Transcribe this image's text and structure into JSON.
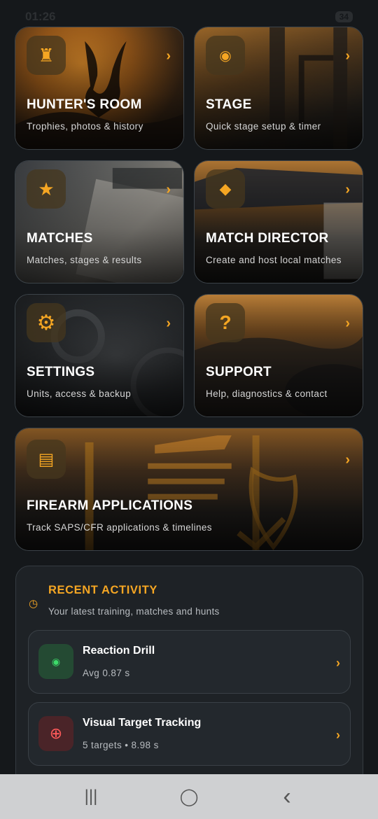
{
  "status": {
    "time": "01:26",
    "battery": "34"
  },
  "tiles": [
    {
      "title": "HUNTER'S ROOM",
      "subtitle": "Trophies, photos & history",
      "icon": "trophy-icon",
      "glyph": "♜"
    },
    {
      "title": "STAGE",
      "subtitle": "Quick stage setup & timer",
      "icon": "target-icon",
      "glyph": "◉"
    },
    {
      "title": "MATCHES",
      "subtitle": "Matches, stages & results",
      "icon": "star-icon",
      "glyph": "★"
    },
    {
      "title": "MATCH DIRECTOR",
      "subtitle": "Create and host local matches",
      "icon": "diamond-icon",
      "glyph": "◆"
    },
    {
      "title": "SETTINGS",
      "subtitle": "Units, access & backup",
      "icon": "gear-icon",
      "glyph": "⚙"
    },
    {
      "title": "SUPPORT",
      "subtitle": "Help, diagnostics & contact",
      "icon": "help-icon",
      "glyph": "?"
    },
    {
      "title": "FIREARM APPLICATIONS",
      "subtitle": "Track SAPS/CFR applications & timelines",
      "icon": "document-icon",
      "glyph": "▤"
    }
  ],
  "chevron": "›",
  "activity": {
    "title": "RECENT ACTIVITY",
    "subtitle": "Your latest training, matches and hunts",
    "items": [
      {
        "title": "Reaction Drill",
        "subtitle": "Avg 0.87 s",
        "glyph": "◉",
        "color": "#3ddc6a",
        "bg": "#244a33"
      },
      {
        "title": "Visual Target Tracking",
        "subtitle": "5 targets • 8.98 s",
        "glyph": "⊕",
        "color": "#ff5a5a",
        "bg": "#4a2428"
      }
    ]
  },
  "colors": {
    "accent": "#f5a623",
    "background": "#15181b"
  },
  "nav": {
    "recents": "|||",
    "home": "◯",
    "back": "‹"
  }
}
